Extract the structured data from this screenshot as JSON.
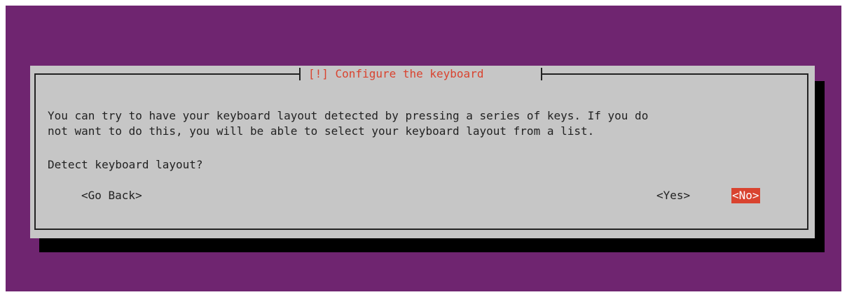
{
  "dialog": {
    "title": "[!] Configure the keyboard",
    "message_line1": "You can try to have your keyboard layout detected by pressing a series of keys. If you do",
    "message_line2": "not want to do this, you will be able to select your keyboard layout from a list.",
    "question": "Detect keyboard layout?",
    "buttons": {
      "go_back": "<Go Back>",
      "yes": "<Yes>",
      "no": "<No>"
    },
    "selected_button": "no"
  },
  "colors": {
    "background": "#6f2570",
    "dialog": "#c6c6c6",
    "accent": "#d9432f",
    "shadow": "#000000"
  }
}
